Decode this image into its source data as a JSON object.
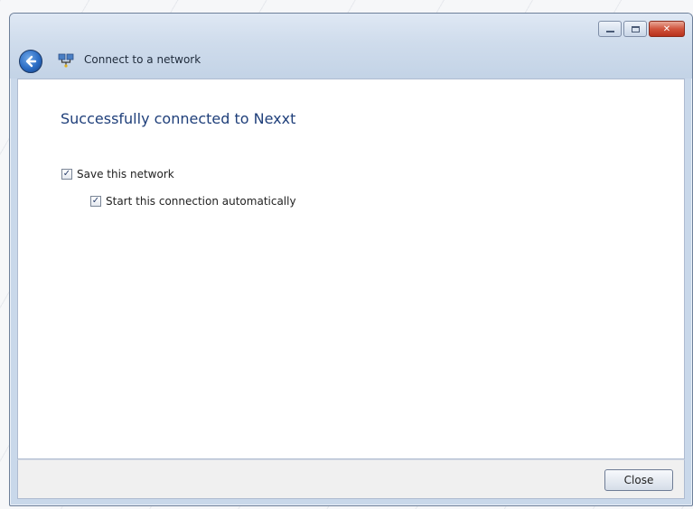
{
  "window": {
    "title": "Connect to a network",
    "caption_buttons": {
      "minimize_icon": "minimize-icon",
      "maximize_icon": "maximize-icon",
      "close_glyph": "✕"
    }
  },
  "nav": {
    "back_icon": "back-arrow-icon",
    "network_icon": "network-icon"
  },
  "main": {
    "heading": "Successfully connected to Nexxt",
    "options": [
      {
        "label": "Save this network",
        "checked": true
      },
      {
        "label": "Start this connection automatically",
        "checked": true
      }
    ]
  },
  "footer": {
    "close_label": "Close"
  },
  "colors": {
    "heading": "#1f3f7a",
    "titlebar": "#cfdcec",
    "close_caption": "#d0543d"
  }
}
